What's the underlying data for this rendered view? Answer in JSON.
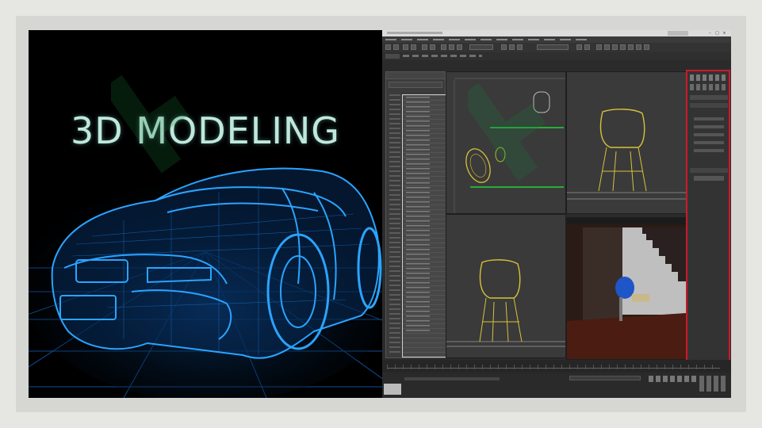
{
  "left": {
    "title": "3D MODELING"
  },
  "app": {
    "window_title": "",
    "menu_items": [
      "",
      "",
      "",
      "",
      "",
      "",
      "",
      "",
      "",
      "",
      "",
      "",
      ""
    ],
    "viewport_labels": [
      "",
      "",
      "",
      ""
    ],
    "render_vp_title": ""
  },
  "colors": {
    "wire_blue": "#1e9bff",
    "chair_yellow": "#d8c23a",
    "selection_red": "#d0182a",
    "watermark_green": "#1a7a3a"
  },
  "icons": [
    "minimize-icon",
    "maximize-icon",
    "close-icon",
    "watermark-logo-icon"
  ]
}
